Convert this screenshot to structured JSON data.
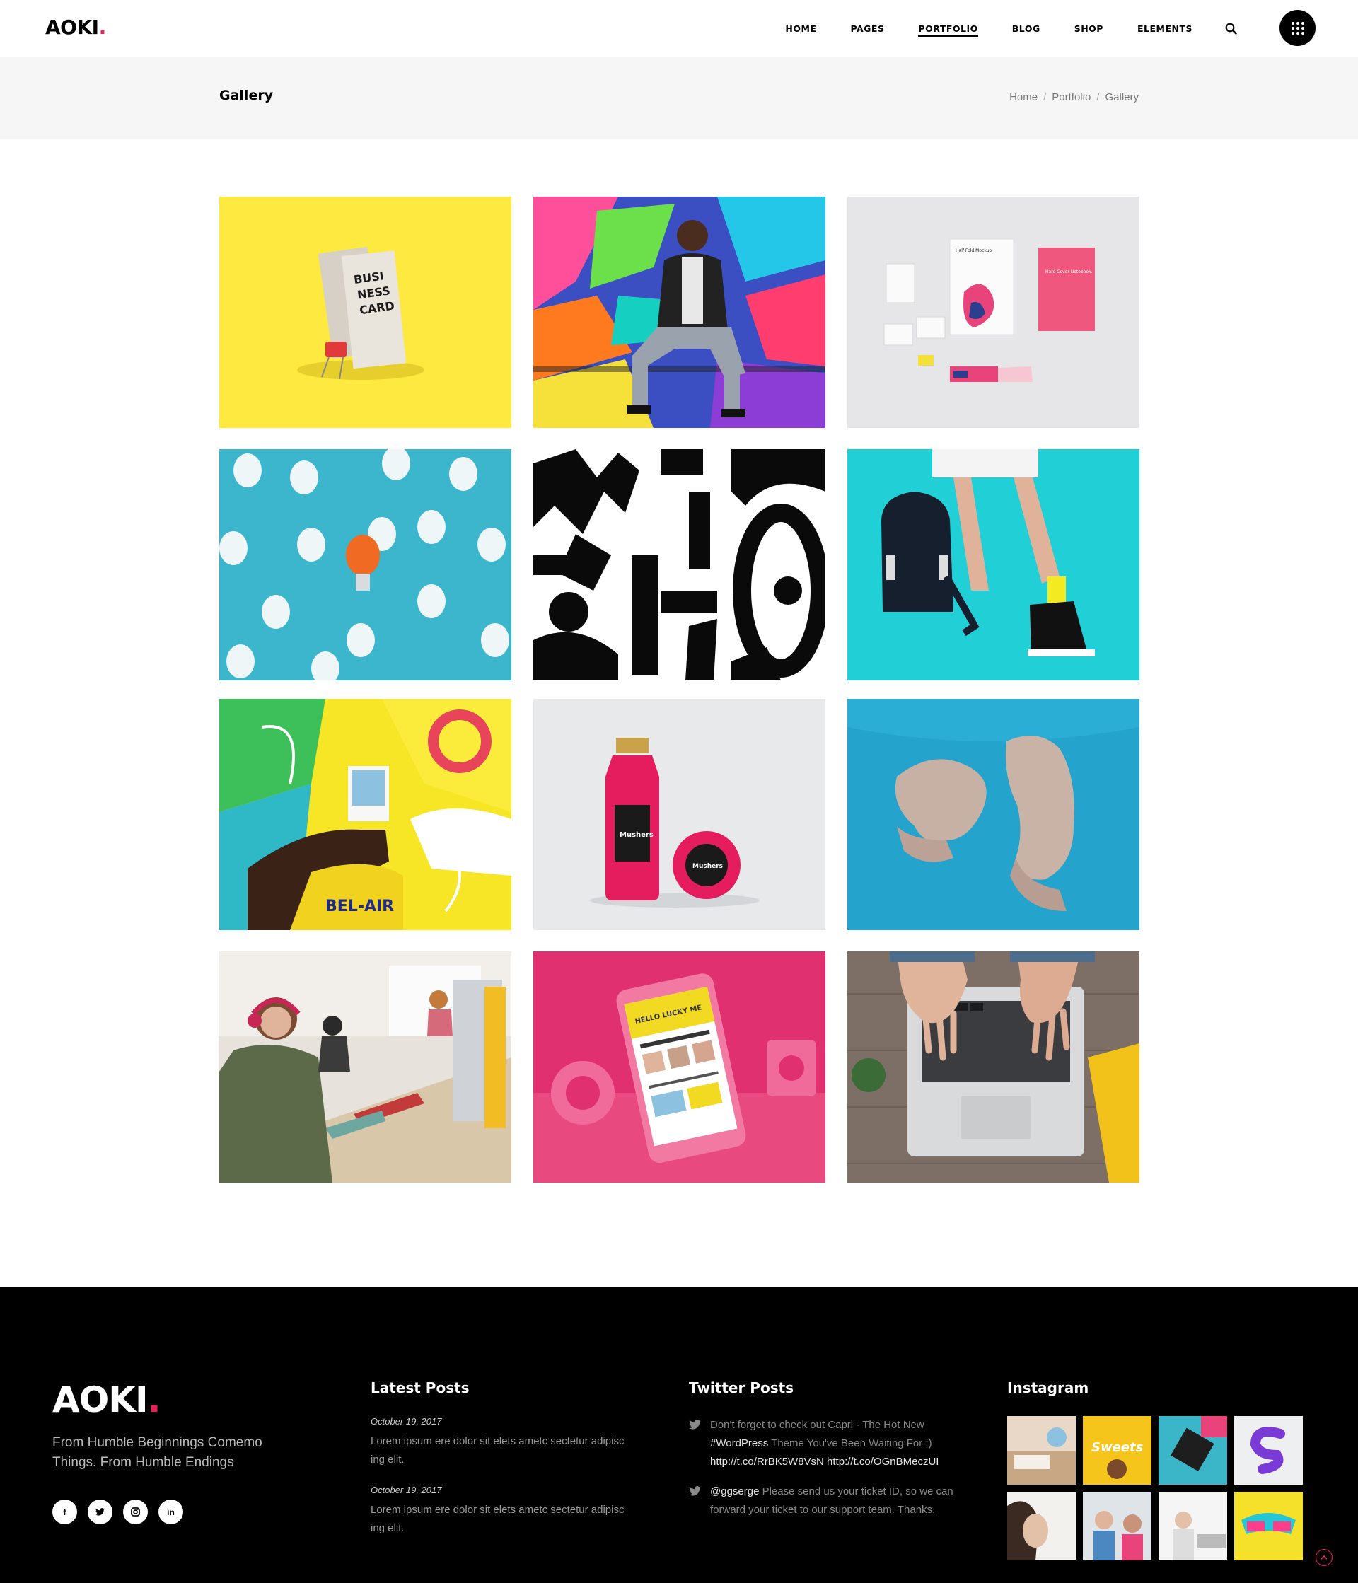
{
  "header": {
    "logo": "AOKI",
    "logo_dot": ".",
    "nav": [
      {
        "label": "HOME",
        "active": false
      },
      {
        "label": "PAGES",
        "active": false
      },
      {
        "label": "PORTFOLIO",
        "active": true
      },
      {
        "label": "BLOG",
        "active": false
      },
      {
        "label": "SHOP",
        "active": false
      },
      {
        "label": "ELEMENTS",
        "active": false
      }
    ],
    "search_icon": "search-icon",
    "menu_icon": "grid-menu-icon"
  },
  "titlebar": {
    "title": "Gallery",
    "breadcrumb": [
      "Home",
      "Portfolio",
      "Gallery"
    ],
    "separator": "/"
  },
  "gallery": {
    "items": [
      {
        "subject": "business card mockup on yellow",
        "text": [
          "BUSI",
          "NESS",
          "CARD"
        ]
      },
      {
        "subject": "man sitting in front of graffiti wall"
      },
      {
        "subject": "stationery brand mockup",
        "text": [
          "Half Fold Mockup",
          "Hard Cover Notebook."
        ]
      },
      {
        "subject": "light bulbs on blue with orange bulb"
      },
      {
        "subject": "black and white lettering pattern"
      },
      {
        "subject": "backpack and sneakers on cyan"
      },
      {
        "subject": "hand holding polaroid against colorful wall"
      },
      {
        "subject": "pink juice bottle mockup",
        "text": [
          "Mushers"
        ]
      },
      {
        "subject": "hands on blue background"
      },
      {
        "subject": "woman with headphones in office"
      },
      {
        "subject": "pink phone mockup",
        "text": [
          "HELLO LUCKY ME"
        ]
      },
      {
        "subject": "hands typing on laptop"
      }
    ]
  },
  "footer": {
    "logo": "AOKI",
    "logo_dot": ".",
    "tagline": "From Humble Beginnings Comemo Things. From Humble Endings",
    "socials": [
      {
        "icon": "facebook-icon",
        "glyph": "f"
      },
      {
        "icon": "twitter-icon",
        "glyph": "t"
      },
      {
        "icon": "instagram-icon",
        "glyph": "◎"
      },
      {
        "icon": "linkedin-icon",
        "glyph": "in"
      }
    ],
    "latest_posts": {
      "heading": "Latest Posts",
      "posts": [
        {
          "date": "October 19, 2017",
          "text": "Lorem ipsum ere dolor sit elets ametc sectetur adipisc ing elit."
        },
        {
          "date": "October 19, 2017",
          "text": "Lorem ipsum ere dolor sit elets ametc sectetur adipisc ing elit."
        }
      ]
    },
    "twitter": {
      "heading": "Twitter Posts",
      "tweets": [
        {
          "parts": [
            {
              "t": "Don't forget to check out Capri - The Hot New ",
              "hl": false
            },
            {
              "t": "#WordPress",
              "hl": true
            },
            {
              "t": " Theme You've Been Waiting For ;) ",
              "hl": false
            },
            {
              "t": "http://t.co/RrBK5W8VsN http://t.co/OGnBMeczUI",
              "hl": true
            }
          ]
        },
        {
          "parts": [
            {
              "t": "@ggserge",
              "hl": true
            },
            {
              "t": " Please send us your ticket ID, so we can forward your ticket to our support team. Thanks.",
              "hl": false
            }
          ]
        }
      ]
    },
    "instagram": {
      "heading": "Instagram",
      "count": 8
    },
    "back_to_top_icon": "arrow-up-icon",
    "accent": "#e8215a"
  }
}
